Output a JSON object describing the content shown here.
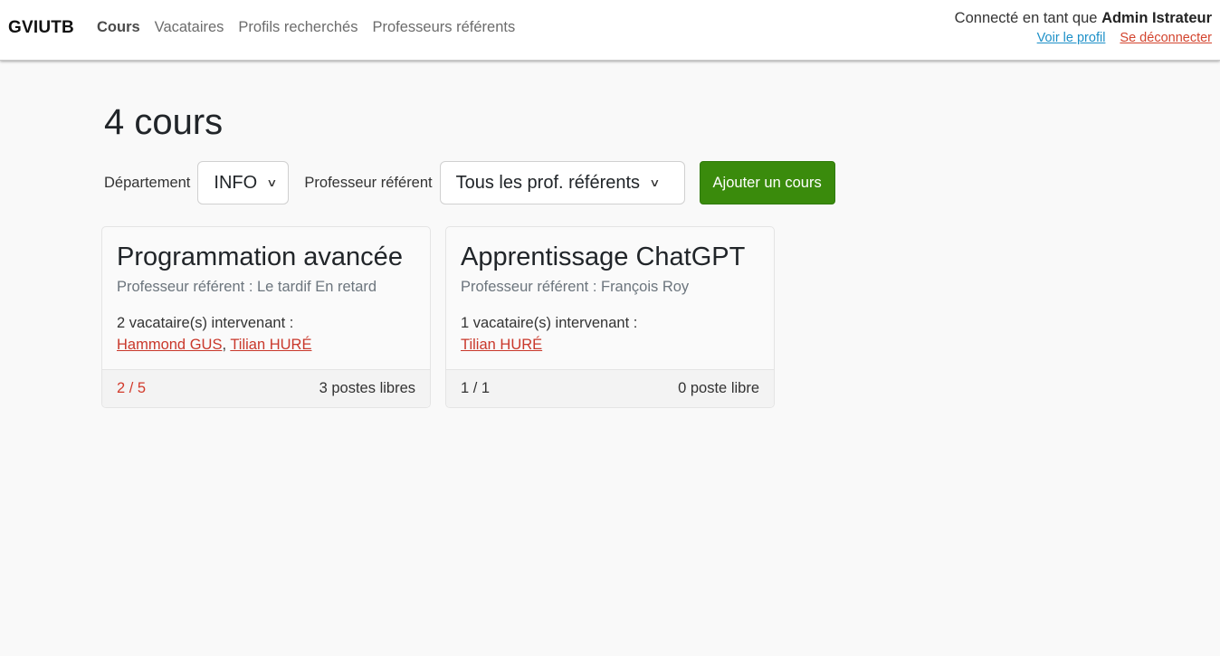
{
  "navbar": {
    "brand": "GVIUTB",
    "links": [
      {
        "label": "Cours",
        "active": true
      },
      {
        "label": "Vacataires"
      },
      {
        "label": "Profils recherchés"
      },
      {
        "label": "Professeurs référents"
      }
    ],
    "user": {
      "prefix": "Connecté en tant que",
      "name": "Admin Istrateur",
      "profile_link": "Voir le profil",
      "logout_link": "Se déconnecter"
    }
  },
  "main": {
    "title": "4 cours",
    "filters": {
      "dept_label": "Département",
      "dept_value": "INFO",
      "prof_label": "Professeur référent",
      "prof_value": "Tous les prof. référents",
      "add_button": "Ajouter un cours"
    },
    "cards": [
      {
        "title": "Programmation avancée",
        "prof": "Professeur référent : Le tardif En retard",
        "vacataires_label": "2 vacataire(s) intervenant :",
        "vacataires": [
          "Hammond GUS",
          "Tilian HURÉ"
        ],
        "separator": ", ",
        "ratio": "2 / 5",
        "postes": "3 postes libres"
      },
      {
        "title": "Apprentissage ChatGPT",
        "prof": "Professeur référent : François Roy",
        "vacataires_label": "1 vacataire(s) intervenant :",
        "vacataires": [
          "Tilian HURÉ"
        ],
        "ratio": "1 / 1",
        "postes": "0 poste libre"
      }
    ]
  },
  "colors": {
    "accent_green": "#3a8b0c",
    "link_blue": "#1d90c8",
    "link_red": "#c9382b",
    "background": "#f9f9f9"
  },
  "icons": {
    "select_chevron": "chevron-down-icon"
  }
}
